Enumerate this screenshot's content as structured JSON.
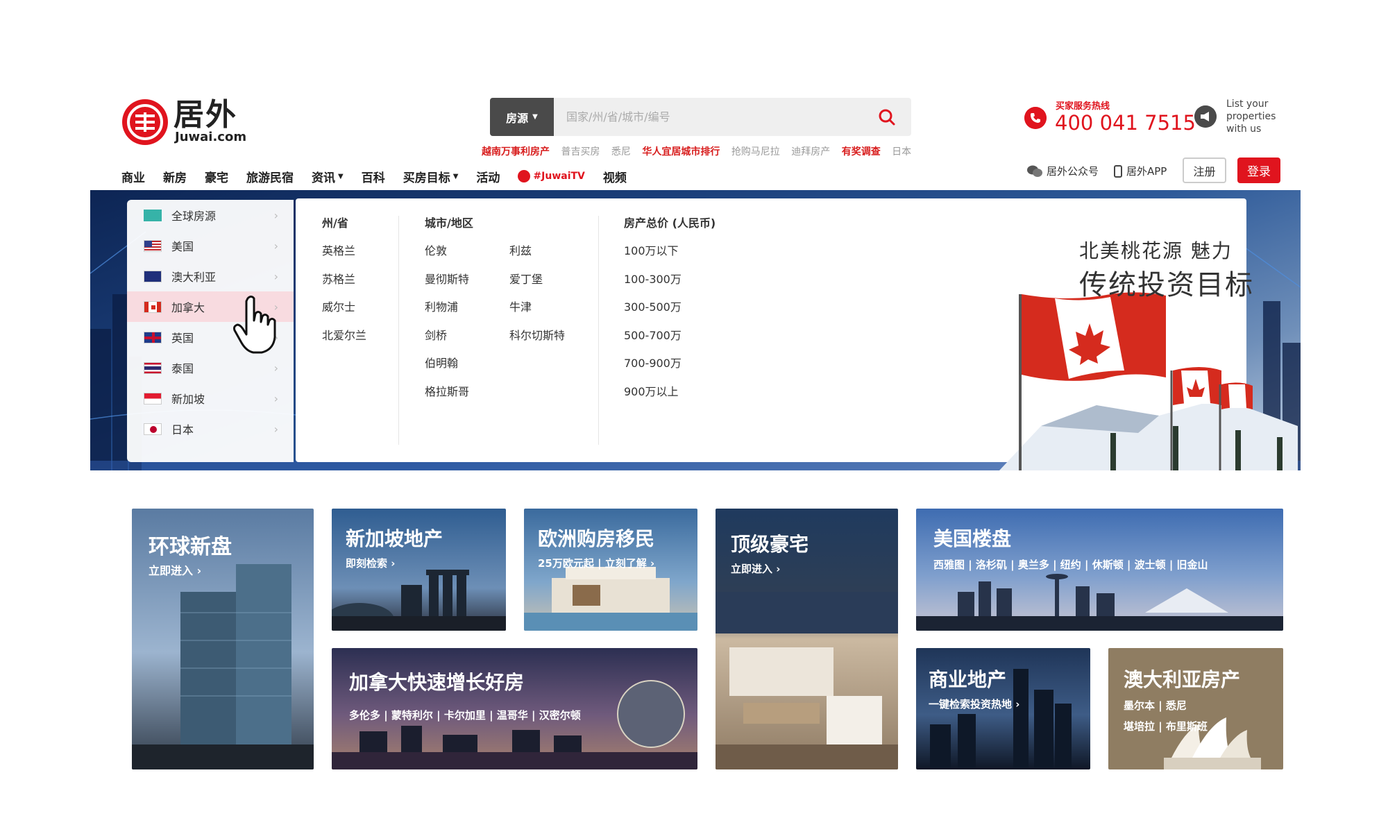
{
  "logo": {
    "brand": "居外",
    "domain": "Juwai.com",
    "tm": "™"
  },
  "search": {
    "category_label": "房源",
    "placeholder": "国家/州/省/城市/编号",
    "hot_links": [
      {
        "label": "越南万事利房产",
        "highlight": true
      },
      {
        "label": "普吉买房",
        "highlight": false
      },
      {
        "label": "悉尼",
        "highlight": false
      },
      {
        "label": "华人宜居城市排行",
        "highlight": true
      },
      {
        "label": "抢购马尼拉",
        "highlight": false
      },
      {
        "label": "迪拜房产",
        "highlight": false
      },
      {
        "label": "有奖调查",
        "highlight": true
      },
      {
        "label": "日本",
        "highlight": false
      }
    ]
  },
  "hotline": {
    "label": "买家服务热线",
    "number": "400 041 7515"
  },
  "list_property": {
    "line1": "List your",
    "line2": "properties",
    "line3": "with us"
  },
  "nav": {
    "items": [
      "商业",
      "新房",
      "豪宅",
      "旅游民宿",
      "资讯",
      "百科",
      "买房目标",
      "活动"
    ],
    "dropdown_items": [
      "资讯",
      "买房目标"
    ],
    "juwai_tv": "#JuwaiTV",
    "video": "视频"
  },
  "user": {
    "wechat": "居外公众号",
    "app": "居外APP",
    "register": "注册",
    "login": "登录"
  },
  "hero": {
    "countries": [
      {
        "label": "全球房源",
        "flag": "globe"
      },
      {
        "label": "美国",
        "flag": "us"
      },
      {
        "label": "澳大利亚",
        "flag": "au"
      },
      {
        "label": "加拿大",
        "flag": "ca",
        "active": true
      },
      {
        "label": "英国",
        "flag": "uk"
      },
      {
        "label": "泰国",
        "flag": "th"
      },
      {
        "label": "新加坡",
        "flag": "sg"
      },
      {
        "label": "日本",
        "flag": "jp"
      }
    ],
    "columns": {
      "region_head": "州/省",
      "regions": [
        "英格兰",
        "苏格兰",
        "威尔士",
        "北爱尔兰"
      ],
      "city_head": "城市/地区",
      "cities_a": [
        "伦敦",
        "曼彻斯特",
        "利物浦",
        "剑桥",
        "伯明翰",
        "格拉斯哥"
      ],
      "cities_b": [
        "利兹",
        "爱丁堡",
        "牛津",
        "科尔切斯特"
      ],
      "price_head": "房产总价 (人民币)",
      "prices": [
        "100万以下",
        "100-300万",
        "300-500万",
        "500-700万",
        "700-900万",
        "900万以上"
      ]
    },
    "promo": {
      "line1": "北美桃花源 魅力",
      "line2": "传统投资目标"
    },
    "accent_color": "#e0141e"
  },
  "tiles": {
    "global": {
      "title": "环球新盘",
      "sub": "立即进入 ›"
    },
    "singapore": {
      "title": "新加坡地产",
      "sub": "即刻检索 ›"
    },
    "europe": {
      "title": "欧洲购房移民",
      "sub": "25万欧元起 | 立刻了解 ›"
    },
    "luxury": {
      "title": "顶级豪宅",
      "sub": "立即进入 ›"
    },
    "usa": {
      "title": "美国楼盘",
      "sub": "西雅图 | 洛杉矶 | 奥兰多 | 纽约 | 休斯顿 | 波士顿 | 旧金山"
    },
    "canada": {
      "title": "加拿大快速增长好房",
      "sub": "多伦多 | 蒙特利尔 | 卡尔加里 | 温哥华 | 汉密尔顿"
    },
    "commercial": {
      "title": "商业地产",
      "sub": "一键检索投资热地 ›"
    },
    "australia": {
      "title": "澳大利亚房产",
      "sub1": "墨尔本 | 悉尼",
      "sub2": "堪培拉 | 布里斯班"
    }
  }
}
